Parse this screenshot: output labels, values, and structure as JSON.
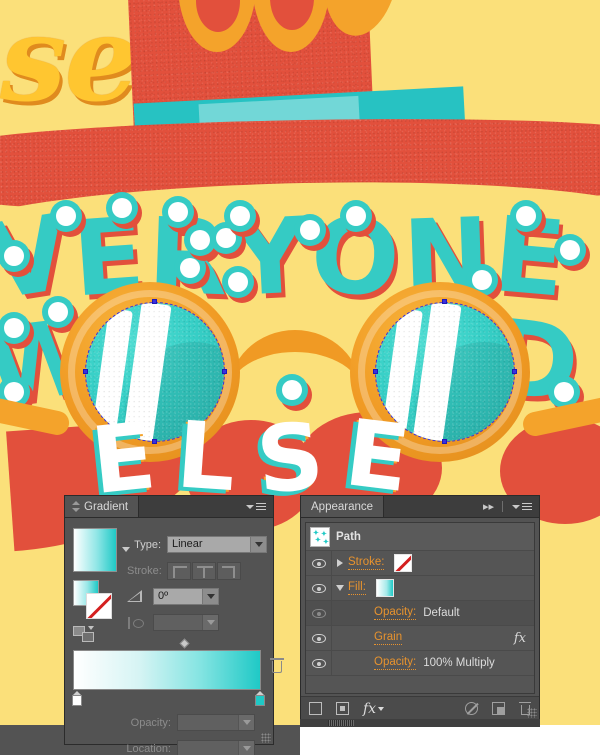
{
  "artwork": {
    "script_word": "self",
    "row_everyone": [
      "V",
      "E",
      "R",
      "Y",
      "O",
      "N",
      "E"
    ],
    "row_left": [
      "W",
      "O"
    ],
    "row_right": [
      "D"
    ],
    "row_else": [
      "E",
      "L",
      "S",
      "E"
    ],
    "colors": {
      "background_yellow": "#FBE07A",
      "red": "#E2503C",
      "orange": "#F4A32B",
      "teal": "#35CBC4",
      "script_yellow": "#FFC630",
      "white": "#FFFFFF",
      "selection_blue": "#3A2FE0"
    }
  },
  "gradient_panel": {
    "tab_label": "Gradient",
    "type_label": "Type:",
    "type_value": "Linear",
    "stroke_label": "Stroke:",
    "angle_value": "0º",
    "aspect_value": "",
    "opacity_label": "Opacity:",
    "opacity_value": "",
    "location_label": "Location:",
    "location_value": "",
    "gradient_start_color": "#FFFFFF",
    "gradient_end_color": "#1FC9C6"
  },
  "appearance_panel": {
    "tab_label": "Appearance",
    "target_label": "Path",
    "rows": [
      {
        "label": "Stroke:",
        "value": "",
        "swatch": "none"
      },
      {
        "label": "Fill:",
        "value": "",
        "swatch": "gradient"
      },
      {
        "label": "Opacity:",
        "value": "Default",
        "swatch": ""
      },
      {
        "label": "Grain",
        "value": "",
        "swatch": "",
        "fx": "fx"
      },
      {
        "label": "Opacity:",
        "value": "100% Multiply",
        "swatch": ""
      }
    ],
    "footer_icons": [
      "add-new-stroke-icon",
      "add-new-fill-icon",
      "add-new-effect-icon",
      "clear-appearance-icon",
      "duplicate-item-icon",
      "delete-item-icon"
    ]
  }
}
